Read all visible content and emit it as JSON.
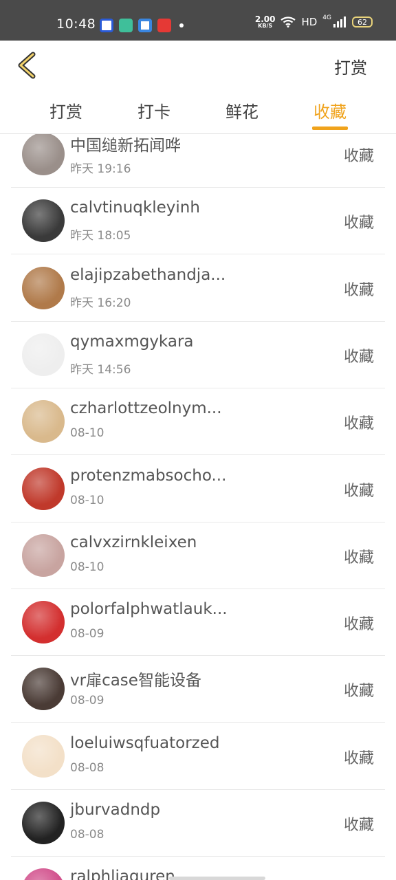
{
  "status_bar": {
    "time": "10:48",
    "net_speed_value": "2.00",
    "net_speed_unit": "KB/S",
    "hd": "HD",
    "signal_label": "4G",
    "battery": "62"
  },
  "header": {
    "action_label": "打赏"
  },
  "tabs": [
    {
      "label": "打赏"
    },
    {
      "label": "打卡"
    },
    {
      "label": "鲜花"
    },
    {
      "label": "收藏"
    }
  ],
  "active_tab": 3,
  "items": [
    {
      "name": "中国缒新拓闻哗",
      "date": "昨天 19:16",
      "action": "收藏",
      "avatar_color": "#9a8f8a"
    },
    {
      "name": "calvtinuqkleyinh",
      "date": "昨天 18:05",
      "action": "收藏",
      "avatar_color": "#3a3a3a"
    },
    {
      "name": "elajipzabethandja...",
      "date": "昨天 16:20",
      "action": "收藏",
      "avatar_color": "#b07a4a"
    },
    {
      "name": "qymaxmgykara",
      "date": "昨天 14:56",
      "action": "收藏",
      "avatar_color": "#eeeeee"
    },
    {
      "name": "czharlottzeolnym...",
      "date": "08-10",
      "action": "收藏",
      "avatar_color": "#d9b98c"
    },
    {
      "name": "protenzmabsocho...",
      "date": "08-10",
      "action": "收藏",
      "avatar_color": "#c0392b"
    },
    {
      "name": "calvxzirnkleixen",
      "date": "08-10",
      "action": "收藏",
      "avatar_color": "#c8a4a0"
    },
    {
      "name": "polorfalphwatlauk...",
      "date": "08-09",
      "action": "收藏",
      "avatar_color": "#d32f2f"
    },
    {
      "name": "vr扉case智能设备",
      "date": "08-09",
      "action": "收藏",
      "avatar_color": "#4a3b35"
    },
    {
      "name": "loeluiwsqfuatorzed",
      "date": "08-08",
      "action": "收藏",
      "avatar_color": "#f3e0c8"
    },
    {
      "name": "jburvadndp",
      "date": "08-08",
      "action": "收藏",
      "avatar_color": "#222222"
    },
    {
      "name": "ralphliaguren",
      "date": "",
      "action": "",
      "avatar_color": "#d14d8a"
    }
  ],
  "colors": {
    "accent": "#f0a31c",
    "status_bar_bg": "#4a4a4a"
  }
}
